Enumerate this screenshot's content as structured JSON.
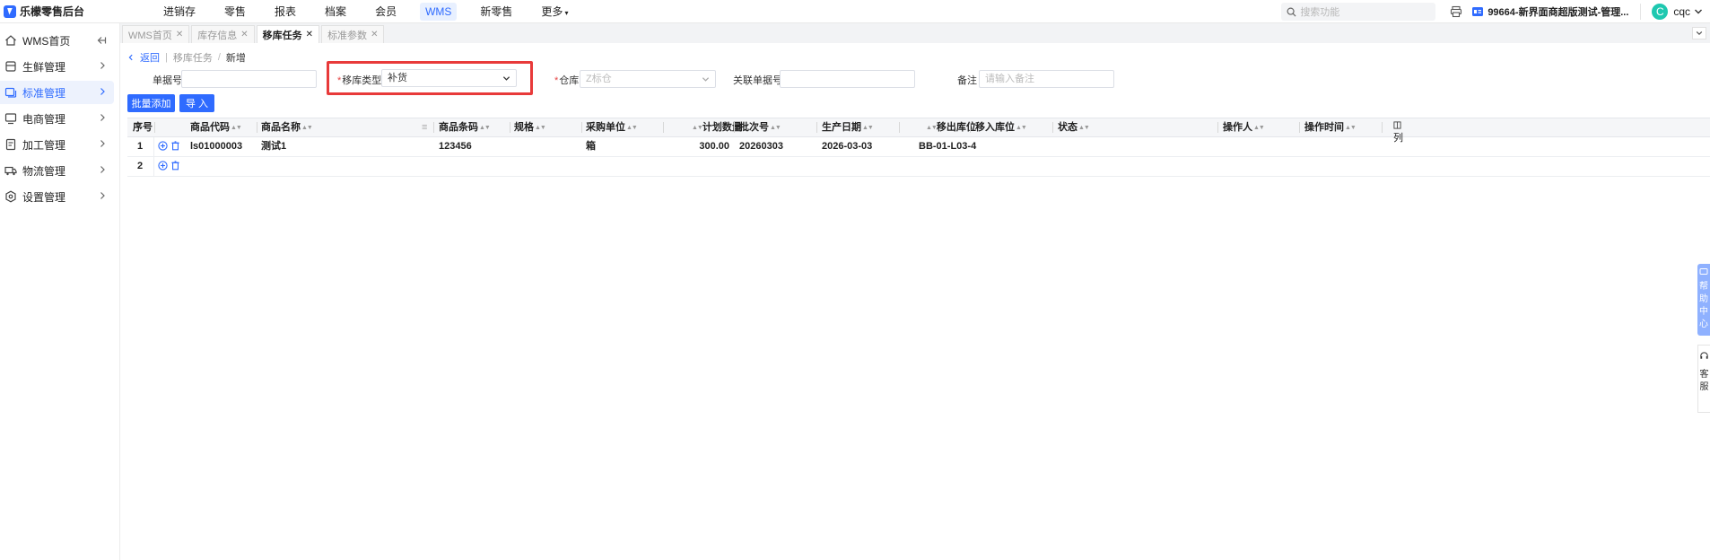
{
  "app": {
    "title": "乐檬零售后台"
  },
  "topnav": {
    "items": [
      "进销存",
      "零售",
      "报表",
      "档案",
      "会员",
      "WMS",
      "新零售",
      "更多"
    ],
    "active": "WMS"
  },
  "top_right": {
    "search_placeholder": "搜索功能",
    "store_name": "99664-新界面商超版测试-管理...",
    "avatar_letter": "C",
    "user_name": "cqc"
  },
  "sidebar": {
    "items": [
      {
        "label": "WMS首页",
        "icon": "home-icon"
      },
      {
        "label": "生鲜管理",
        "icon": "fresh-icon"
      },
      {
        "label": "标准管理",
        "icon": "standard-icon"
      },
      {
        "label": "电商管理",
        "icon": "ecommerce-icon"
      },
      {
        "label": "加工管理",
        "icon": "process-icon"
      },
      {
        "label": "物流管理",
        "icon": "truck-icon"
      },
      {
        "label": "设置管理",
        "icon": "settings-icon"
      }
    ],
    "active": "标准管理"
  },
  "tabs": [
    {
      "label": "WMS首页"
    },
    {
      "label": "库存信息"
    },
    {
      "label": "移库任务"
    },
    {
      "label": "标准参数"
    }
  ],
  "active_tab": "移库任务",
  "breadcrumb": {
    "back": "返回",
    "parent": "移库任务",
    "current": "新增"
  },
  "form": {
    "doc_no": {
      "label": "单据号",
      "value": ""
    },
    "move_type": {
      "label": "移库类型",
      "value": "补货",
      "required": true
    },
    "warehouse": {
      "label": "仓库",
      "value": "Z标仓",
      "required": true
    },
    "related_no": {
      "label": "关联单据号",
      "value": ""
    },
    "remark": {
      "label": "备注",
      "placeholder": "请输入备注"
    }
  },
  "buttons": {
    "batch_add": "批量添加",
    "import": "导 入"
  },
  "table": {
    "columns": [
      "序号",
      "商品代码",
      "商品名称",
      "商品条码",
      "规格",
      "采购单位",
      "计划数量",
      "批次号",
      "生产日期",
      "移出库位",
      "移入库位",
      "状态",
      "操作人",
      "操作时间"
    ],
    "column_setting": "列",
    "rows": [
      {
        "no": "1",
        "code": "ls01000003",
        "name": "测试1",
        "barcode": "123456",
        "spec": "",
        "unit": "箱",
        "qty": "300.00",
        "batch": "20260303",
        "date": "2026-03-03",
        "out_loc": "BB-01-L03-4",
        "in_loc": "",
        "status": "",
        "operator": "",
        "op_time": ""
      },
      {
        "no": "2",
        "code": "",
        "name": "",
        "barcode": "",
        "spec": "",
        "unit": "",
        "qty": "",
        "batch": "",
        "date": "",
        "out_loc": "",
        "in_loc": "",
        "status": "",
        "operator": "",
        "op_time": ""
      }
    ]
  },
  "floating": {
    "help": "帮助中心",
    "service": "客服"
  },
  "colors": {
    "primary": "#2f6bff",
    "highlight_border": "#e83a3a",
    "required": "#e64545",
    "avatar": "#1ec8b0"
  }
}
